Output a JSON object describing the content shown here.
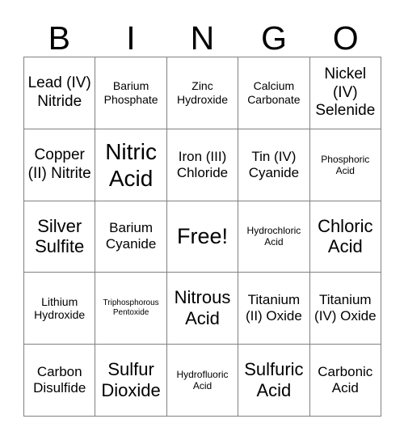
{
  "header": {
    "letters": [
      "B",
      "I",
      "N",
      "G",
      "O"
    ]
  },
  "grid": {
    "rows": 5,
    "columns": 5,
    "border_color": "#808080",
    "background_color": "#ffffff",
    "text_color": "#000000",
    "cells": [
      {
        "text": "Lead (IV) Nitride",
        "size": "fs-lg"
      },
      {
        "text": "Barium Phosphate",
        "size": "fs-sm"
      },
      {
        "text": "Zinc Hydroxide",
        "size": "fs-sm"
      },
      {
        "text": "Calcium Carbonate",
        "size": "fs-sm"
      },
      {
        "text": "Nickel (IV) Selenide",
        "size": "fs-lg"
      },
      {
        "text": "Copper (II) Nitrite",
        "size": "fs-lg"
      },
      {
        "text": "Nitric Acid",
        "size": "fs-xxl"
      },
      {
        "text": "Iron (III) Chloride",
        "size": "fs-md"
      },
      {
        "text": "Tin (IV) Cyanide",
        "size": "fs-md"
      },
      {
        "text": "Phosphoric Acid",
        "size": "fs-xs"
      },
      {
        "text": "Silver Sulfite",
        "size": "fs-xl"
      },
      {
        "text": "Barium Cyanide",
        "size": "fs-md"
      },
      {
        "text": "Free!",
        "size": "free"
      },
      {
        "text": "Hydrochloric Acid",
        "size": "fs-xs"
      },
      {
        "text": "Chloric Acid",
        "size": "fs-xl"
      },
      {
        "text": "Lithium Hydroxide",
        "size": "fs-sm"
      },
      {
        "text": "Triphosphorous Pentoxide",
        "size": "fs-xxs"
      },
      {
        "text": "Nitrous Acid",
        "size": "fs-xl"
      },
      {
        "text": "Titanium (II) Oxide",
        "size": "fs-md"
      },
      {
        "text": "Titanium (IV) Oxide",
        "size": "fs-md"
      },
      {
        "text": "Carbon Disulfide",
        "size": "fs-md"
      },
      {
        "text": "Sulfur Dioxide",
        "size": "fs-xl"
      },
      {
        "text": "Hydrofluoric Acid",
        "size": "fs-xs"
      },
      {
        "text": "Sulfuric Acid",
        "size": "fs-xl"
      },
      {
        "text": "Carbonic Acid",
        "size": "fs-md"
      }
    ]
  }
}
